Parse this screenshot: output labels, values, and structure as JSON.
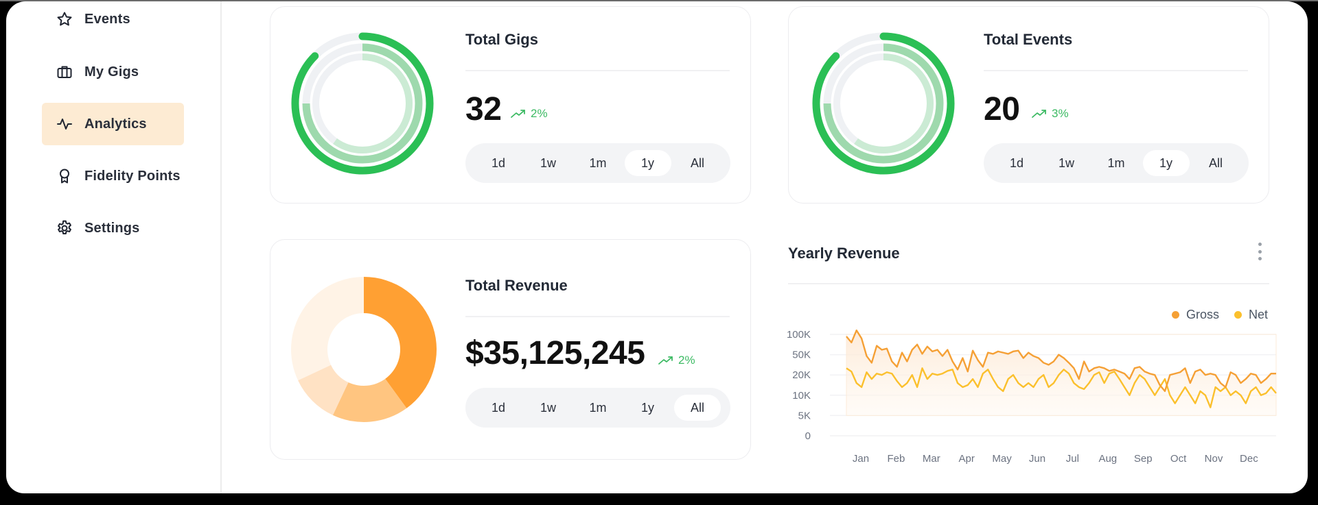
{
  "sidebar": {
    "items": [
      {
        "label": "Events",
        "icon": "star-icon",
        "active": false
      },
      {
        "label": "My Gigs",
        "icon": "briefcase-icon",
        "active": false
      },
      {
        "label": "Analytics",
        "icon": "activity-icon",
        "active": true
      },
      {
        "label": "Fidelity Points",
        "icon": "award-icon",
        "active": false
      },
      {
        "label": "Settings",
        "icon": "gear-icon",
        "active": false
      }
    ]
  },
  "colors": {
    "accent_highlight": "#fdebd3",
    "green_strong": "#2bbf55",
    "green_mid": "#9ed9ad",
    "green_light": "#cbebd4",
    "ring_track": "#eff1f4",
    "delta_green": "#3cba63",
    "orange_dark": "#ffa033",
    "orange_mid": "#ffc580",
    "orange_light": "#ffe2c4",
    "orange_pale": "#fff3e6",
    "gross": "#f5a035",
    "net": "#fbc02d"
  },
  "cards": {
    "gigs": {
      "title": "Total Gigs",
      "value": "32",
      "delta": "2%",
      "rings": [
        0.875,
        0.75,
        0.6
      ],
      "periods": [
        "1d",
        "1w",
        "1m",
        "1y",
        "All"
      ],
      "selected_period": "1y"
    },
    "events": {
      "title": "Total Events",
      "value": "20",
      "delta": "3%",
      "rings": [
        0.875,
        0.75,
        0.6
      ],
      "periods": [
        "1d",
        "1w",
        "1m",
        "1y",
        "All"
      ],
      "selected_period": "1y"
    },
    "revenue": {
      "title": "Total Revenue",
      "value": "$35,125,245",
      "delta": "2%",
      "slices": [
        0.4,
        0.17,
        0.11,
        0.32
      ],
      "periods": [
        "1d",
        "1w",
        "1m",
        "1y",
        "All"
      ],
      "selected_period": "All"
    }
  },
  "chart_data": {
    "type": "line",
    "title": "Yearly Revenue",
    "xlabel": "",
    "ylabel": "",
    "categories": [
      "Jan",
      "Feb",
      "Mar",
      "Apr",
      "May",
      "Jun",
      "Jul",
      "Aug",
      "Sep",
      "Oct",
      "Nov",
      "Dec"
    ],
    "y_ticks": [
      "0",
      "5K",
      "10K",
      "20K",
      "50K",
      "100K"
    ],
    "y_tick_values": [
      0,
      5000,
      10000,
      20000,
      50000,
      100000
    ],
    "ylim": [
      0,
      100000
    ],
    "grid": true,
    "legend": "top-right",
    "series": [
      {
        "name": "Gross",
        "color": "#f5a035",
        "values": [
          95000,
          80000,
          110000,
          90000,
          48000,
          38000,
          72000,
          62000,
          65000,
          40000,
          32000,
          55000,
          40000,
          62000,
          75000,
          52000,
          70000,
          58000,
          62000,
          48000,
          62000,
          40000,
          28000,
          45000,
          25000,
          60000,
          42000,
          32000,
          55000,
          52000,
          58000,
          55000,
          52000,
          58000,
          60000,
          45000,
          55000,
          48000,
          45000,
          38000,
          35000,
          40000,
          50000,
          45000,
          38000,
          30000,
          18000,
          40000,
          25000,
          30000,
          32000,
          30000,
          26000,
          28000,
          25000,
          22000,
          18000,
          30000,
          32000,
          25000,
          22000,
          20000,
          15000,
          12000,
          20000,
          22000,
          24000,
          30000,
          16000,
          25000,
          28000,
          20000,
          22000,
          20000,
          16000,
          14000,
          24000,
          20000,
          16000,
          18000,
          22000,
          20000,
          16000,
          18000,
          22000,
          22000
        ]
      },
      {
        "name": "Net",
        "color": "#fbc02d",
        "values": [
          30000,
          25000,
          16000,
          14000,
          24000,
          18000,
          22000,
          20000,
          24000,
          22000,
          17000,
          14000,
          16000,
          20000,
          14000,
          30000,
          18000,
          22000,
          20000,
          22000,
          26000,
          28000,
          16000,
          14000,
          15000,
          18000,
          14000,
          22000,
          28000,
          18000,
          14000,
          12000,
          18000,
          20000,
          16000,
          14000,
          16000,
          14000,
          18000,
          20000,
          14000,
          16000,
          20000,
          28000,
          22000,
          16000,
          14000,
          13000,
          16000,
          20000,
          24000,
          16000,
          22000,
          25000,
          18000,
          14000,
          10000,
          16000,
          20000,
          18000,
          14000,
          10000,
          14000,
          18000,
          10000,
          8000,
          10000,
          14000,
          10000,
          8000,
          12000,
          10000,
          7000,
          14000,
          12000,
          14000,
          10000,
          12000,
          10000,
          8000,
          12000,
          14000,
          10000,
          11000,
          14000,
          11000
        ]
      }
    ]
  },
  "chart_menu": {
    "icon": "kebab-menu-icon"
  }
}
